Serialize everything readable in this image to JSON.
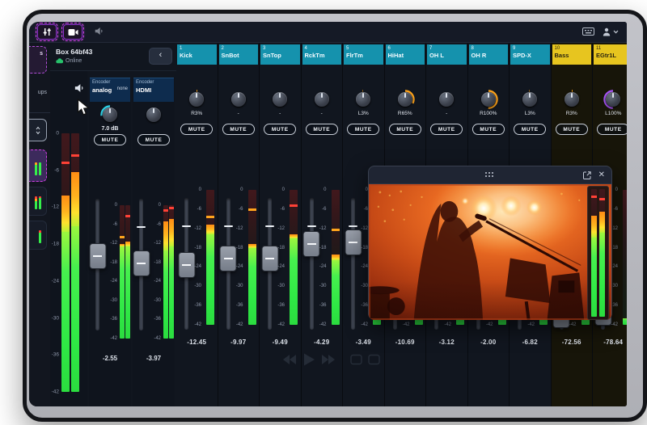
{
  "app": {
    "toolbar": {
      "mixer_button_icon": "mixer-faders",
      "camera_button_icon": "video-camera",
      "volume_icon": "speaker",
      "keyboard_icon": "keyboard",
      "user_icon": "person"
    },
    "sidebar": {
      "item1_fragment": "s",
      "item2_fragment": "ups"
    },
    "box_panel": {
      "title": "Box 64bf43",
      "status": "Online",
      "back_button": "‹",
      "master_meter": {
        "bars": [
          {
            "g": 0.62,
            "o": 0.76,
            "p": 0.89,
            "pc": "#ff4136"
          },
          {
            "g": 0.64,
            "o": 0.85,
            "p": 0.92,
            "pc": "#ff4136"
          }
        ]
      },
      "encoders": [
        {
          "label": "Encoder",
          "name": "analog",
          "extra": "none",
          "gain": "7.0 dB",
          "mute": "MUTE",
          "value": "-2.55",
          "fader": 0.41,
          "tick": "none",
          "arc": {
            "dir": "L",
            "pct": 55,
            "color": "#2fd3e8"
          },
          "bars": [
            {
              "g": 0.69,
              "o": 0.71,
              "p": 0.77,
              "pc": "#ffa41c"
            },
            {
              "g": 0.69,
              "o": 0.73,
              "p": 0.93,
              "pc": "#ff4136"
            }
          ]
        },
        {
          "label": "Encoder",
          "name": "HDMI",
          "extra": "",
          "gain": "",
          "mute": "MUTE",
          "value": "-3.97",
          "fader": 0.48,
          "tick": "block",
          "arc": null,
          "bars": [
            {
              "g": 0.66,
              "o": 0.88,
              "p": 0.97,
              "pc": "#ff4136"
            },
            {
              "g": 0.69,
              "o": 0.9,
              "p": 0.99,
              "pc": "#ff4136"
            }
          ]
        }
      ]
    },
    "meter_scale": [
      "0",
      "-6",
      "-12",
      "-18",
      "-24",
      "-30",
      "-36",
      "-42"
    ],
    "channels": [
      {
        "num": "1",
        "name": "Kick",
        "pan": "R3%",
        "mute": "MUTE",
        "value": "-12.45",
        "color": "#1592ad",
        "text": "#f2fbff",
        "body": "#11161f",
        "fader": 0.5,
        "meter": {
          "g": 0.67,
          "o": 0.74,
          "p": 0.81,
          "pc": "#ffa41c"
        },
        "arc": {
          "dir": "R",
          "pct": 3,
          "color": "#ffa41c"
        }
      },
      {
        "num": "2",
        "name": "SnBot",
        "pan": "-",
        "mute": "MUTE",
        "value": "-9.97",
        "color": "#1592ad",
        "text": "#f2fbff",
        "body": "#11161f",
        "fader": 0.44,
        "meter": {
          "g": 0.57,
          "o": 0.6,
          "p": 0.86,
          "pc": "#ffa41c"
        },
        "arc": null
      },
      {
        "num": "3",
        "name": "SnTop",
        "pan": "-",
        "mute": "MUTE",
        "value": "-9.49",
        "color": "#1592ad",
        "text": "#f2fbff",
        "body": "#11161f",
        "fader": 0.44,
        "meter": {
          "g": 0.64,
          "o": 0.67,
          "p": 0.89,
          "pc": "#ff4136"
        },
        "arc": null
      },
      {
        "num": "4",
        "name": "RckTm",
        "pan": "-",
        "mute": "MUTE",
        "value": "-4.29",
        "color": "#1592ad",
        "text": "#f2fbff",
        "body": "#11161f",
        "fader": 0.31,
        "meter": {
          "g": 0.48,
          "o": 0.52,
          "p": 0.71,
          "pc": "#ffa41c"
        },
        "arc": null
      },
      {
        "num": "5",
        "name": "FlrTm",
        "pan": "L3%",
        "mute": "MUTE",
        "value": "-3.49",
        "color": "#1592ad",
        "text": "#f2fbff",
        "body": "#11161f",
        "fader": 0.29,
        "meter": {
          "g": 0.55,
          "o": 0.6,
          "p": 0.85,
          "pc": "#ff4136"
        },
        "arc": {
          "dir": "L",
          "pct": 3,
          "color": "#ffa41c"
        }
      },
      {
        "num": "6",
        "name": "HiHat",
        "pan": "R65%",
        "mute": "MUTE",
        "value": "-10.69",
        "color": "#1592ad",
        "text": "#f2fbff",
        "body": "#11161f",
        "fader": 0.4,
        "meter": {
          "g": 0.55,
          "o": 0.58,
          "p": 0.8,
          "pc": "#ffa41c"
        },
        "arc": {
          "dir": "R",
          "pct": 65,
          "color": "#ffa41c"
        }
      },
      {
        "num": "7",
        "name": "OH L",
        "pan": "-",
        "mute": "MUTE",
        "value": "-3.12",
        "color": "#1592ad",
        "text": "#f2fbff",
        "body": "#11161f",
        "fader": 0.4,
        "meter": {
          "g": 0.55,
          "o": 0.58,
          "p": 0.75,
          "pc": "#ff4136"
        },
        "arc": null
      },
      {
        "num": "8",
        "name": "OH R",
        "pan": "R100%",
        "mute": "MUTE",
        "value": "-2.00",
        "color": "#1592ad",
        "text": "#f2fbff",
        "body": "#11161f",
        "fader": 0.4,
        "meter": {
          "g": 0.55,
          "o": 0.58,
          "p": 0.75,
          "pc": "#ff4136"
        },
        "arc": {
          "dir": "R",
          "pct": 100,
          "color": "#ffa41c"
        }
      },
      {
        "num": "9",
        "name": "SPD-X",
        "pan": "L3%",
        "mute": "MUTE",
        "value": "-6.82",
        "color": "#1592ad",
        "text": "#f2fbff",
        "body": "#11161f",
        "fader": 0.4,
        "meter": {
          "g": 0.55,
          "o": 0.58,
          "p": 0.75,
          "pc": "#ff4136"
        },
        "arc": {
          "dir": "L",
          "pct": 3,
          "color": "#ffa41c"
        }
      },
      {
        "num": "10",
        "name": "Bass",
        "pan": "R3%",
        "mute": "MUTE",
        "value": "-72.56",
        "color": "#e7c51f",
        "text": "#2a2410",
        "body": "#171509",
        "fader": 0.97,
        "meter": {
          "g": 0.07,
          "o": 0.07,
          "p": 0,
          "pc": "transparent"
        },
        "arc": {
          "dir": "R",
          "pct": 3,
          "color": "#ffa41c"
        }
      },
      {
        "num": "11",
        "name": "EGtr1L",
        "pan": "L100%",
        "mute": "MUTE",
        "value": "-78.64",
        "color": "#e7c51f",
        "text": "#2a2410",
        "body": "#171509",
        "fader": 0.95,
        "meter": {
          "g": 0.05,
          "o": 0.05,
          "p": 0,
          "pc": "transparent"
        },
        "arc": {
          "dir": "L",
          "pct": 100,
          "color": "#a855f7"
        },
        "stereo": [
          {
            "g": 0.62,
            "o": 0.79,
            "p": 0.95,
            "pc": "#ff4136"
          },
          {
            "g": 0.66,
            "o": 0.82,
            "p": 0.93,
            "pc": "#ff4136"
          }
        ]
      }
    ],
    "video_window": {
      "drag_handle_icon": "drag-dots",
      "popout_icon": "open-external",
      "close_label": "✕"
    }
  }
}
